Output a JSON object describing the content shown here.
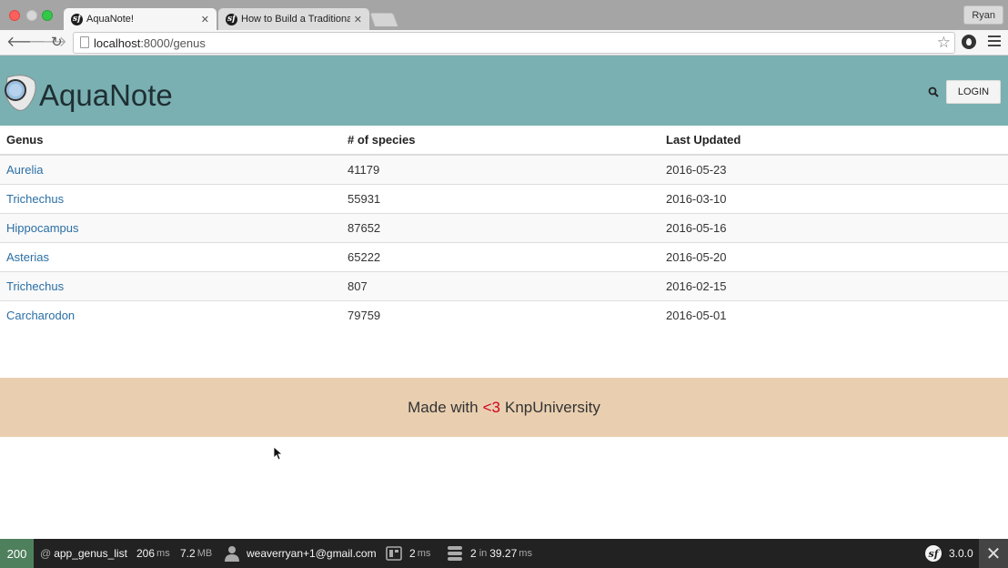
{
  "browser": {
    "tabs": [
      {
        "title": "AquaNote!",
        "close": "✕"
      },
      {
        "title": "How to Build a Traditional L",
        "close": "✕"
      }
    ],
    "profile": "Ryan",
    "url_host": "localhost",
    "url_path": ":8000/genus"
  },
  "header": {
    "brand": "AquaNote",
    "login_label": "LOGIN"
  },
  "table": {
    "columns": [
      "Genus",
      "# of species",
      "Last Updated"
    ],
    "rows": [
      {
        "genus": "Aurelia",
        "species": "41179",
        "updated": "2016-05-23"
      },
      {
        "genus": "Trichechus",
        "species": "55931",
        "updated": "2016-03-10"
      },
      {
        "genus": "Hippocampus",
        "species": "87652",
        "updated": "2016-05-16"
      },
      {
        "genus": "Asterias",
        "species": "65222",
        "updated": "2016-05-20"
      },
      {
        "genus": "Trichechus",
        "species": "807",
        "updated": "2016-02-15"
      },
      {
        "genus": "Carcharodon",
        "species": "79759",
        "updated": "2016-05-01"
      }
    ]
  },
  "footer": {
    "made_with": "Made with",
    "heart": "<3",
    "company": "KnpUniversity"
  },
  "debug_toolbar": {
    "status": "200",
    "route_prefix": "@",
    "route": "app_genus_list",
    "time_value": "206",
    "time_unit": "ms",
    "memory_value": "7.2",
    "memory_unit": "MB",
    "user": "weaverryan+1@gmail.com",
    "twig_value": "2",
    "twig_unit": "ms",
    "db_count": "2",
    "db_in": "in",
    "db_time": "39.27",
    "db_unit": "ms",
    "version": "3.0.0",
    "close": "✕"
  },
  "colors": {
    "header_bg": "#7ab0b2",
    "footer_bg": "#e9cfb0",
    "link": "#2a6fa5",
    "status_ok": "#4f805d"
  }
}
